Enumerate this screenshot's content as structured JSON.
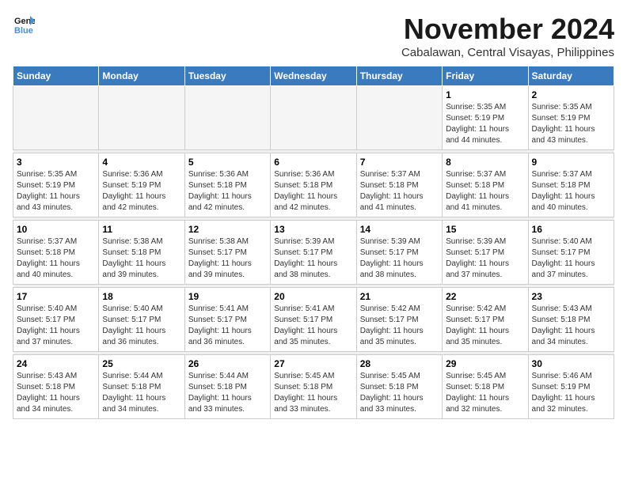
{
  "logo": {
    "line1": "General",
    "line2": "Blue"
  },
  "title": "November 2024",
  "location": "Cabalawan, Central Visayas, Philippines",
  "weekdays": [
    "Sunday",
    "Monday",
    "Tuesday",
    "Wednesday",
    "Thursday",
    "Friday",
    "Saturday"
  ],
  "weeks": [
    [
      {
        "day": "",
        "detail": ""
      },
      {
        "day": "",
        "detail": ""
      },
      {
        "day": "",
        "detail": ""
      },
      {
        "day": "",
        "detail": ""
      },
      {
        "day": "",
        "detail": ""
      },
      {
        "day": "1",
        "detail": "Sunrise: 5:35 AM\nSunset: 5:19 PM\nDaylight: 11 hours\nand 44 minutes."
      },
      {
        "day": "2",
        "detail": "Sunrise: 5:35 AM\nSunset: 5:19 PM\nDaylight: 11 hours\nand 43 minutes."
      }
    ],
    [
      {
        "day": "3",
        "detail": "Sunrise: 5:35 AM\nSunset: 5:19 PM\nDaylight: 11 hours\nand 43 minutes."
      },
      {
        "day": "4",
        "detail": "Sunrise: 5:36 AM\nSunset: 5:19 PM\nDaylight: 11 hours\nand 42 minutes."
      },
      {
        "day": "5",
        "detail": "Sunrise: 5:36 AM\nSunset: 5:18 PM\nDaylight: 11 hours\nand 42 minutes."
      },
      {
        "day": "6",
        "detail": "Sunrise: 5:36 AM\nSunset: 5:18 PM\nDaylight: 11 hours\nand 42 minutes."
      },
      {
        "day": "7",
        "detail": "Sunrise: 5:37 AM\nSunset: 5:18 PM\nDaylight: 11 hours\nand 41 minutes."
      },
      {
        "day": "8",
        "detail": "Sunrise: 5:37 AM\nSunset: 5:18 PM\nDaylight: 11 hours\nand 41 minutes."
      },
      {
        "day": "9",
        "detail": "Sunrise: 5:37 AM\nSunset: 5:18 PM\nDaylight: 11 hours\nand 40 minutes."
      }
    ],
    [
      {
        "day": "10",
        "detail": "Sunrise: 5:37 AM\nSunset: 5:18 PM\nDaylight: 11 hours\nand 40 minutes."
      },
      {
        "day": "11",
        "detail": "Sunrise: 5:38 AM\nSunset: 5:18 PM\nDaylight: 11 hours\nand 39 minutes."
      },
      {
        "day": "12",
        "detail": "Sunrise: 5:38 AM\nSunset: 5:17 PM\nDaylight: 11 hours\nand 39 minutes."
      },
      {
        "day": "13",
        "detail": "Sunrise: 5:39 AM\nSunset: 5:17 PM\nDaylight: 11 hours\nand 38 minutes."
      },
      {
        "day": "14",
        "detail": "Sunrise: 5:39 AM\nSunset: 5:17 PM\nDaylight: 11 hours\nand 38 minutes."
      },
      {
        "day": "15",
        "detail": "Sunrise: 5:39 AM\nSunset: 5:17 PM\nDaylight: 11 hours\nand 37 minutes."
      },
      {
        "day": "16",
        "detail": "Sunrise: 5:40 AM\nSunset: 5:17 PM\nDaylight: 11 hours\nand 37 minutes."
      }
    ],
    [
      {
        "day": "17",
        "detail": "Sunrise: 5:40 AM\nSunset: 5:17 PM\nDaylight: 11 hours\nand 37 minutes."
      },
      {
        "day": "18",
        "detail": "Sunrise: 5:40 AM\nSunset: 5:17 PM\nDaylight: 11 hours\nand 36 minutes."
      },
      {
        "day": "19",
        "detail": "Sunrise: 5:41 AM\nSunset: 5:17 PM\nDaylight: 11 hours\nand 36 minutes."
      },
      {
        "day": "20",
        "detail": "Sunrise: 5:41 AM\nSunset: 5:17 PM\nDaylight: 11 hours\nand 35 minutes."
      },
      {
        "day": "21",
        "detail": "Sunrise: 5:42 AM\nSunset: 5:17 PM\nDaylight: 11 hours\nand 35 minutes."
      },
      {
        "day": "22",
        "detail": "Sunrise: 5:42 AM\nSunset: 5:17 PM\nDaylight: 11 hours\nand 35 minutes."
      },
      {
        "day": "23",
        "detail": "Sunrise: 5:43 AM\nSunset: 5:18 PM\nDaylight: 11 hours\nand 34 minutes."
      }
    ],
    [
      {
        "day": "24",
        "detail": "Sunrise: 5:43 AM\nSunset: 5:18 PM\nDaylight: 11 hours\nand 34 minutes."
      },
      {
        "day": "25",
        "detail": "Sunrise: 5:44 AM\nSunset: 5:18 PM\nDaylight: 11 hours\nand 34 minutes."
      },
      {
        "day": "26",
        "detail": "Sunrise: 5:44 AM\nSunset: 5:18 PM\nDaylight: 11 hours\nand 33 minutes."
      },
      {
        "day": "27",
        "detail": "Sunrise: 5:45 AM\nSunset: 5:18 PM\nDaylight: 11 hours\nand 33 minutes."
      },
      {
        "day": "28",
        "detail": "Sunrise: 5:45 AM\nSunset: 5:18 PM\nDaylight: 11 hours\nand 33 minutes."
      },
      {
        "day": "29",
        "detail": "Sunrise: 5:45 AM\nSunset: 5:18 PM\nDaylight: 11 hours\nand 32 minutes."
      },
      {
        "day": "30",
        "detail": "Sunrise: 5:46 AM\nSunset: 5:19 PM\nDaylight: 11 hours\nand 32 minutes."
      }
    ]
  ]
}
